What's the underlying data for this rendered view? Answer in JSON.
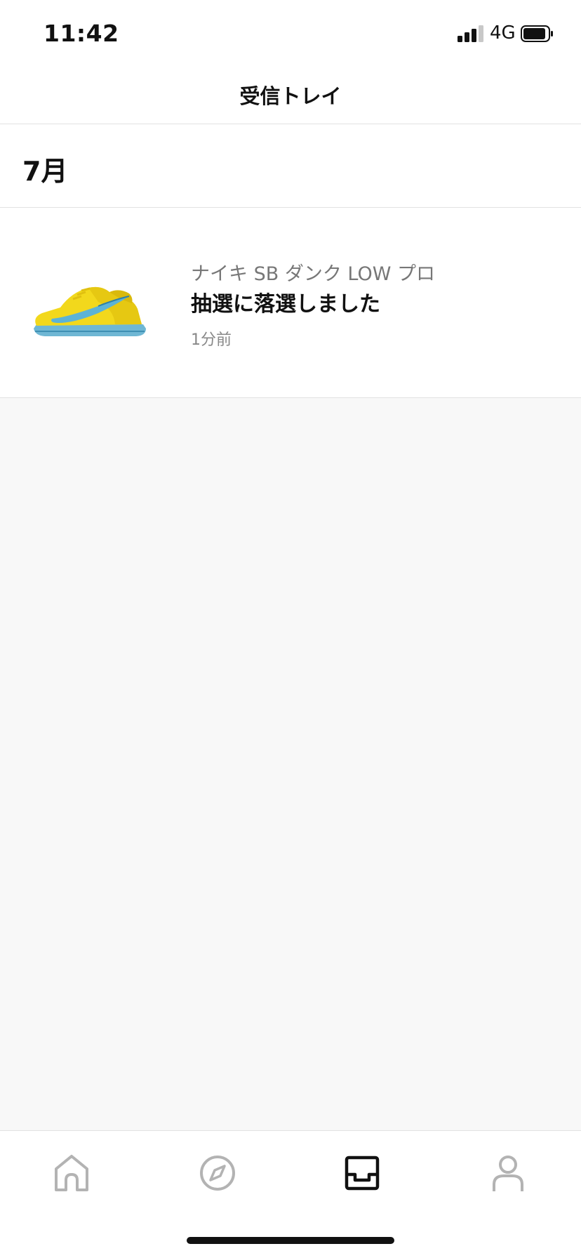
{
  "status_bar": {
    "time": "11:42",
    "network": "4G",
    "signal_bars": 3,
    "battery_level": 0.9
  },
  "header": {
    "title": "受信トレイ"
  },
  "inbox": {
    "month": "7月",
    "notifications": [
      {
        "product": "ナイキ SB ダンク LOW プロ",
        "message": "抽選に落選しました",
        "time": "1分前",
        "thumbnail_icon": "sneaker-thumbnail-icon"
      }
    ]
  },
  "tab_bar": {
    "items": [
      {
        "icon": "home-icon",
        "active": false
      },
      {
        "icon": "compass-icon",
        "active": false
      },
      {
        "icon": "inbox-icon",
        "active": true
      },
      {
        "icon": "profile-icon",
        "active": false
      }
    ]
  },
  "colors": {
    "primary_text": "#111111",
    "secondary_text": "#777777",
    "inactive_icon": "#b3b3b3",
    "background": "#f8f8f8",
    "shoe_yellow": "#f4dd20",
    "swoosh_blue": "#5cb3d6"
  }
}
